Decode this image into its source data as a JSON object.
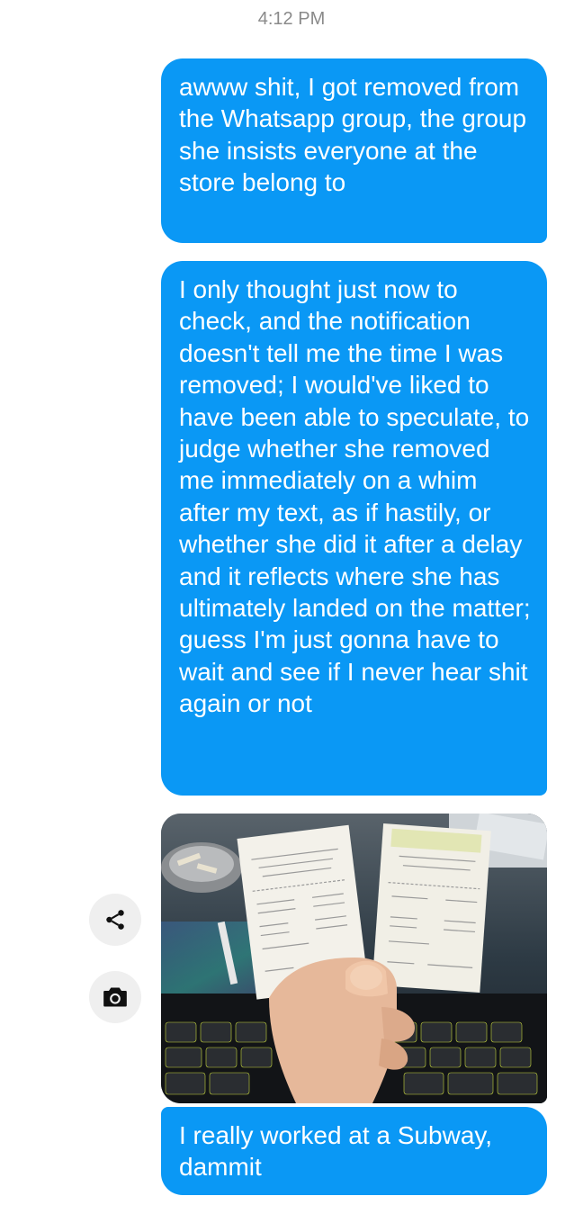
{
  "header": {
    "timestamp": "4:12 PM"
  },
  "messages": [
    {
      "type": "text",
      "direction": "outgoing",
      "text": "awww shit, I got removed from the Whatsapp group, the group she insists everyone at the store belong to"
    },
    {
      "type": "text",
      "direction": "outgoing",
      "text": "I only thought just now to check, and the notification doesn't tell me the time I was removed; I would've liked to have been able to speculate, to judge whether she removed me immediately on a whim after my text, as if hastily, or whether she did it after a delay and it reflects where she has ultimately landed on the matter; guess I'm just gonna have to wait and see if I never hear shit again or not"
    },
    {
      "type": "photo",
      "direction": "outgoing",
      "image_subject": "hand holding two Subway receipts over a keyboard"
    },
    {
      "type": "text",
      "direction": "outgoing",
      "text": "I really worked at a Subway, dammit"
    }
  ],
  "actions": {
    "share_icon": "share-icon",
    "camera_icon": "camera-icon"
  },
  "colors": {
    "bubble": "#0a98f5",
    "bubble_text": "#ffffff",
    "timestamp": "#8a8a8a",
    "action_button": "#efefef"
  }
}
